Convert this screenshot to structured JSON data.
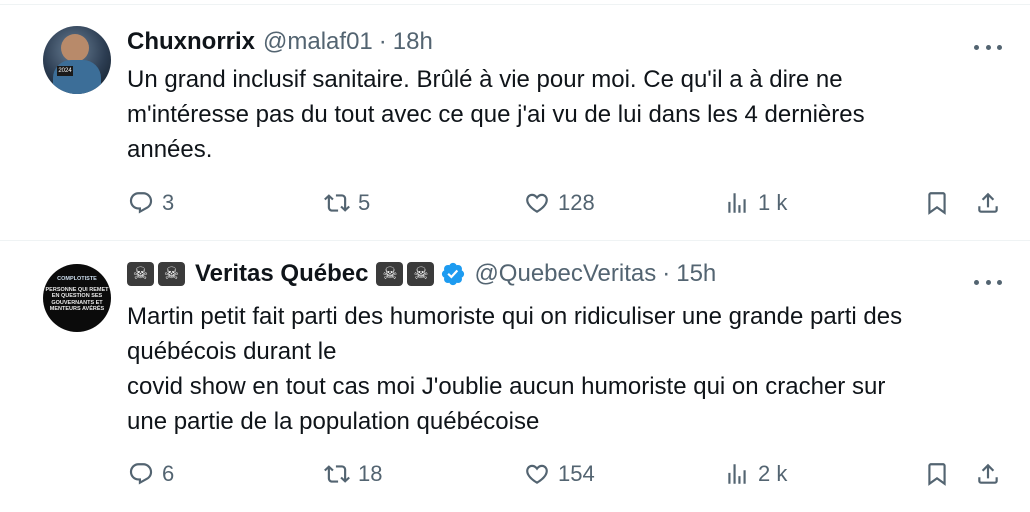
{
  "tweets": [
    {
      "name": "Chuxnorrix",
      "handle": "@malaf01",
      "separator": "·",
      "time": "18h",
      "text_lines": [
        "Un grand inclusif sanitaire.  Brûlé à vie pour moi. Ce qu'il a à dire ne",
        "m'intéresse pas du tout avec ce que j'ai vu de lui dans les 4 dernières",
        "années."
      ],
      "avatar_badge": "2024",
      "replies": "3",
      "reposts": "5",
      "likes": "128",
      "views": "1 k"
    },
    {
      "name": "Veritas Québec",
      "name_emoji": "☠",
      "handle": "@QuebecVeritas",
      "separator": "·",
      "time": "15h",
      "verified": true,
      "text_lines": [
        "Martin petit fait parti des humoriste qui on ridiculiser une grande parti des",
        "québécois durant le",
        "covid show en tout cas moi J'oublie aucun humoriste qui on cracher sur",
        "une partie de la population québécoise"
      ],
      "avatar_text": [
        "COMPLOTISTE",
        "PERSONNE QUI REMET EN QUESTION SES GOUVERNANTS ET MENTEURS AVÉRÉS"
      ],
      "replies": "6",
      "reposts": "18",
      "likes": "154",
      "views": "2 k"
    }
  ],
  "colors": {
    "text_primary": "#0f1419",
    "text_secondary": "#536471",
    "verified_blue": "#1d9bf0",
    "divider": "#eff3f4"
  },
  "icons": [
    "reply-icon",
    "repost-icon",
    "like-icon",
    "views-icon",
    "bookmark-icon",
    "share-icon",
    "more-icon",
    "verified-icon"
  ]
}
